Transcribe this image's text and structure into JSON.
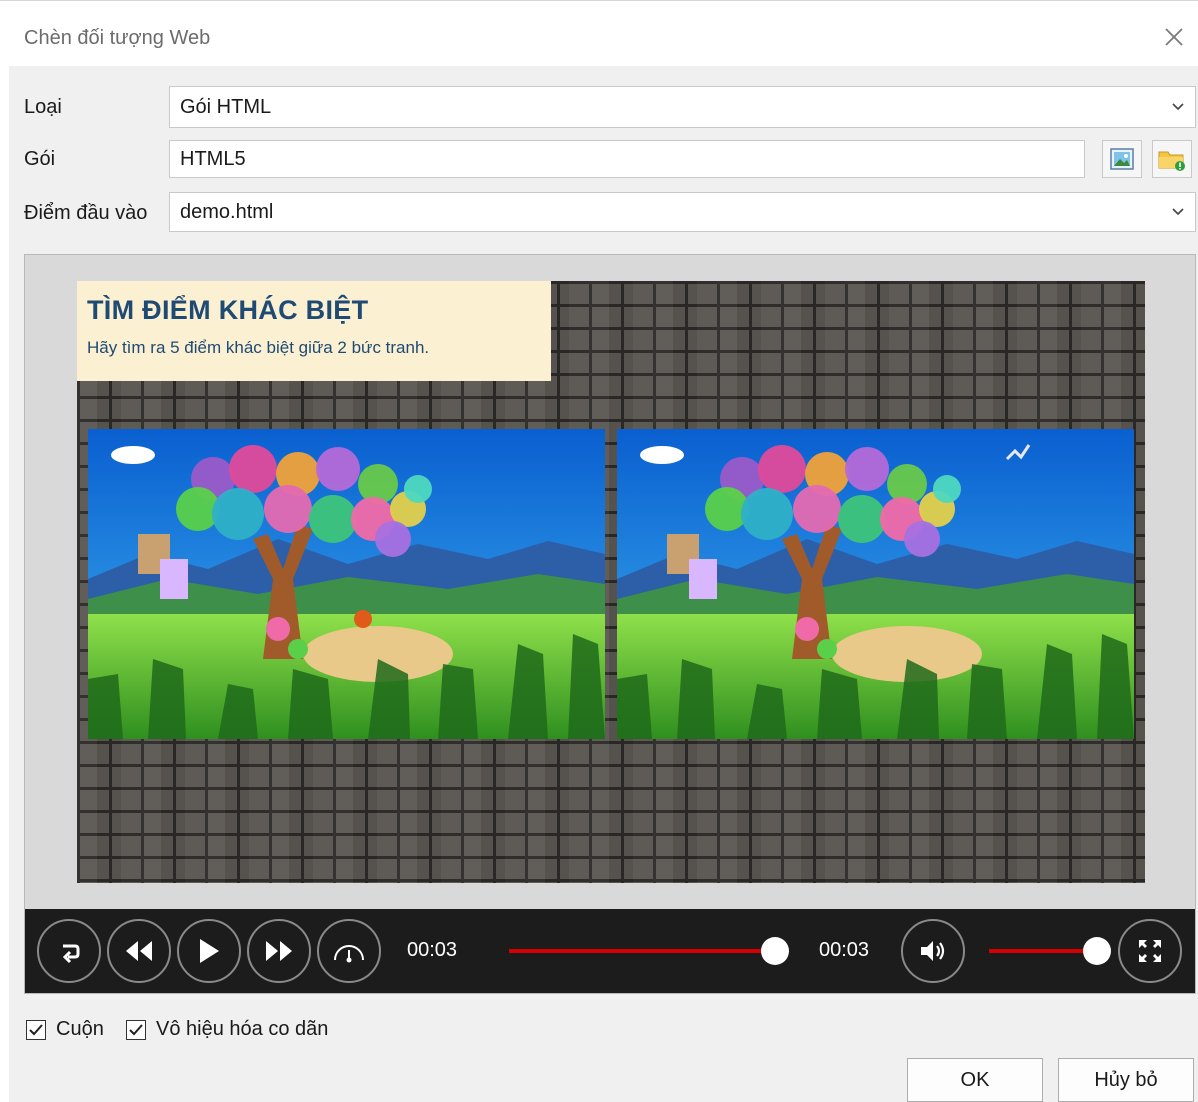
{
  "window": {
    "title": "Chèn đối tượng Web"
  },
  "form": {
    "type_label": "Loại",
    "type_value": "Gói HTML",
    "package_label": "Gói",
    "package_value": "HTML5",
    "entry_label": "Điểm đầu vào",
    "entry_value": "demo.html"
  },
  "icons": {
    "preview": "image-icon",
    "browse": "folder-icon",
    "close": "close-icon",
    "dropdown": "chevron-down-icon"
  },
  "preview": {
    "title": "TÌM ĐIỂM KHÁC BIỆT",
    "subtitle": "Hãy tìm ra 5 điểm khác biệt giữa 2 bức tranh."
  },
  "player": {
    "current_time": "00:03",
    "total_time": "00:03",
    "progress_fraction": 0.95,
    "volume_fraction": 0.95,
    "accent": "#d60000"
  },
  "options": {
    "scroll_label": "Cuộn",
    "scroll_checked": true,
    "disable_zoom_label": "Vô hiệu hóa co dãn",
    "disable_zoom_checked": true
  },
  "buttons": {
    "ok": "OK",
    "cancel": "Hủy bỏ"
  }
}
